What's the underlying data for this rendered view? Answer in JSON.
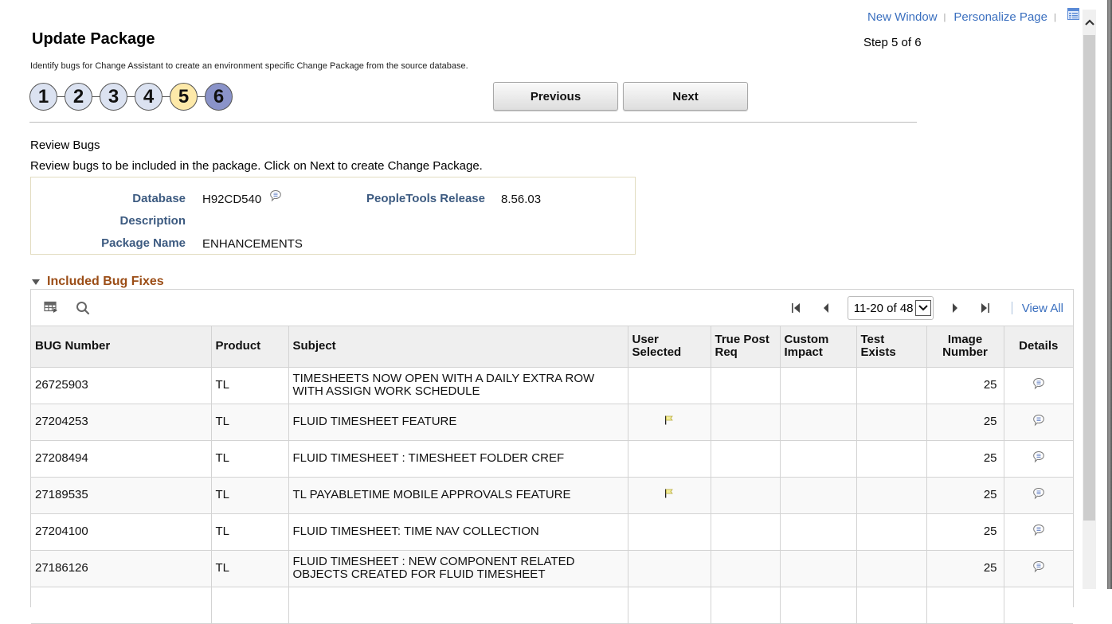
{
  "header": {
    "new_window": "New Window",
    "personalize_page": "Personalize Page",
    "separator": "|",
    "page_title": "Update Package",
    "step_info": "Step 5 of 6",
    "instructions": "Identify bugs for Change Assistant to create an environment specific Change Package from the source database."
  },
  "steps": [
    {
      "label": "1",
      "state": "done"
    },
    {
      "label": "2",
      "state": "done"
    },
    {
      "label": "3",
      "state": "done"
    },
    {
      "label": "4",
      "state": "done"
    },
    {
      "label": "5",
      "state": "current"
    },
    {
      "label": "6",
      "state": "future"
    }
  ],
  "buttons": {
    "previous": "Previous",
    "next": "Next"
  },
  "review": {
    "title": "Review Bugs",
    "description": "Review bugs to be included in the package.  Click on Next to create Change Package."
  },
  "info": {
    "database_label": "Database",
    "database_value": "H92CD540",
    "peopletools_label": "PeopleTools Release",
    "peopletools_value": "8.56.03",
    "description_label": "Description",
    "description_value": "",
    "package_name_label": "Package Name",
    "package_name_value": "ENHANCEMENTS"
  },
  "grid": {
    "section_title": "Included Bug Fixes",
    "pager_range": "11-20 of 48",
    "view_all": "View All",
    "columns": [
      "BUG Number",
      "Product",
      "Subject",
      "User Selected",
      "True Post Req",
      "Custom Impact",
      "Test Exists",
      "Image Number",
      "Details"
    ],
    "rows": [
      {
        "bug": "26725903",
        "product": "TL",
        "subject": "TIMESHEETS NOW OPEN WITH A DAILY EXTRA ROW WITH ASSIGN WORK SCHEDULE",
        "user_selected": false,
        "true_post_req": "",
        "custom_impact": "",
        "test_exists": "",
        "image": "25"
      },
      {
        "bug": "27204253",
        "product": "TL",
        "subject": "FLUID TIMESHEET FEATURE",
        "user_selected": true,
        "true_post_req": "",
        "custom_impact": "",
        "test_exists": "",
        "image": "25"
      },
      {
        "bug": "27208494",
        "product": "TL",
        "subject": "FLUID TIMESHEET : TIMESHEET FOLDER CREF",
        "user_selected": false,
        "true_post_req": "",
        "custom_impact": "",
        "test_exists": "",
        "image": "25"
      },
      {
        "bug": "27189535",
        "product": "TL",
        "subject": "TL PAYABLETIME MOBILE APPROVALS FEATURE",
        "user_selected": true,
        "true_post_req": "",
        "custom_impact": "",
        "test_exists": "",
        "image": "25"
      },
      {
        "bug": "27204100",
        "product": "TL",
        "subject": "FLUID TIMESHEET: TIME NAV COLLECTION",
        "user_selected": false,
        "true_post_req": "",
        "custom_impact": "",
        "test_exists": "",
        "image": "25"
      },
      {
        "bug": "27186126",
        "product": "TL",
        "subject": "FLUID TIMESHEET :  NEW COMPONENT RELATED OBJECTS CREATED FOR FLUID TIMESHEET",
        "user_selected": false,
        "true_post_req": "",
        "custom_impact": "",
        "test_exists": "",
        "image": "25"
      },
      {
        "bug": "",
        "product": "",
        "subject": "",
        "user_selected": false,
        "true_post_req": "",
        "custom_impact": "",
        "test_exists": "",
        "image": ""
      }
    ]
  }
}
